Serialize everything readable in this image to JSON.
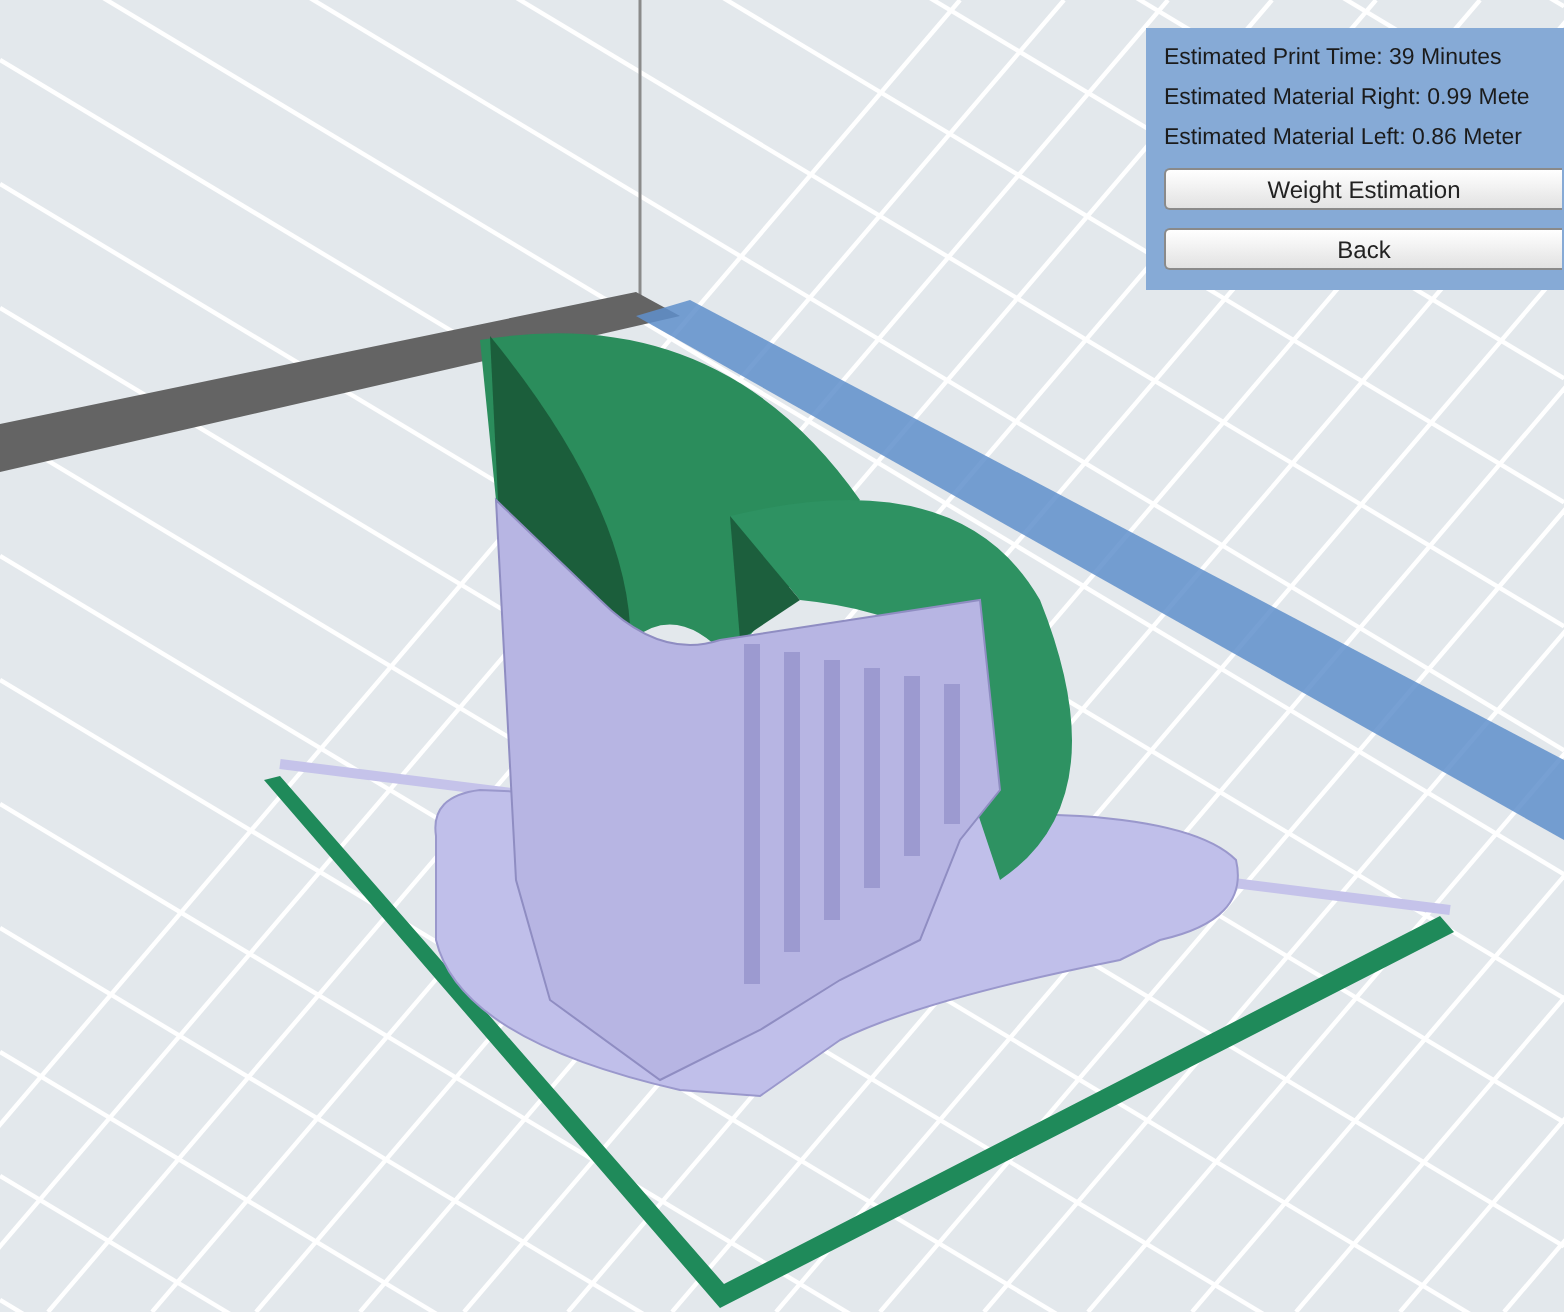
{
  "estimates": [
    "Estimated Print Time: 39 Minutes",
    "Estimated Material Right: 0.99 Mete",
    "Estimated Material Left: 0.86 Meter"
  ],
  "buttons": [
    {
      "label": "Weight Estimation"
    },
    {
      "label": "Back"
    }
  ]
}
